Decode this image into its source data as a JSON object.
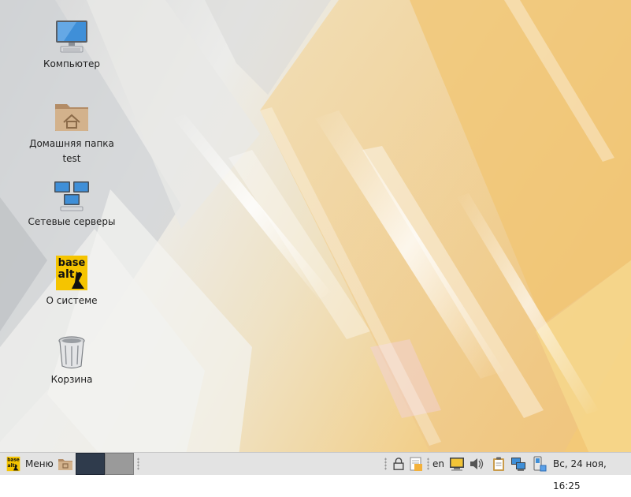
{
  "desktop": {
    "icons": [
      {
        "label": "Компьютер"
      },
      {
        "label": "Домашняя папка",
        "sublabel": "test"
      },
      {
        "label": "Сетевые серверы"
      },
      {
        "label": "О системе",
        "logo_top": "base",
        "logo_bottom": "alt"
      },
      {
        "label": "Корзина"
      }
    ]
  },
  "taskbar": {
    "menu_label": "Меню",
    "menu_logo_top": "base",
    "menu_logo_bottom": "alt",
    "keyboard_layout": "en",
    "clock": "Вс, 24 ноя, 16:25"
  },
  "colors": {
    "taskbar_bg": "#e3e3e3",
    "logo_yellow": "#f5c400",
    "wallpaper_warm": "#f0c878",
    "wallpaper_cool": "#e6e6e6"
  }
}
